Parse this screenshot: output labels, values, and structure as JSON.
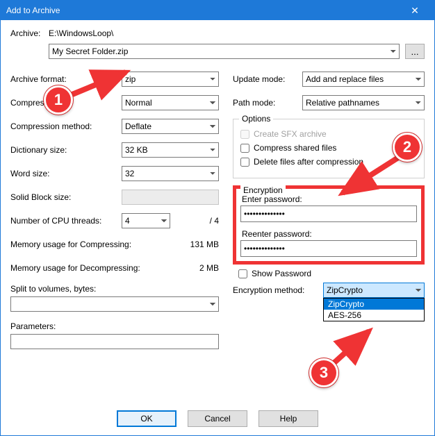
{
  "window": {
    "title": "Add to Archive"
  },
  "archive": {
    "label": "Archive:",
    "path": "E:\\WindowsLoop\\",
    "filename": "My Secret Folder.zip",
    "browse": "..."
  },
  "left": {
    "format_label": "Archive format:",
    "format_value": "zip",
    "level_label": "Compressi",
    "level_value": "Normal",
    "method_label": "Compression method:",
    "method_value": "Deflate",
    "dict_label": "Dictionary size:",
    "dict_value": "32 KB",
    "word_label": "Word size:",
    "word_value": "32",
    "solid_label": "Solid Block size:",
    "solid_value": "",
    "threads_label": "Number of CPU threads:",
    "threads_value": "4",
    "threads_max": "/ 4",
    "mem_comp_label": "Memory usage for Compressing:",
    "mem_comp_value": "131 MB",
    "mem_decomp_label": "Memory usage for Decompressing:",
    "mem_decomp_value": "2 MB",
    "split_label": "Split to volumes, bytes:",
    "params_label": "Parameters:"
  },
  "right": {
    "update_label": "Update mode:",
    "update_value": "Add and replace files",
    "path_label": "Path mode:",
    "path_value": "Relative pathnames",
    "options_title": "Options",
    "opt_sfx": "Create SFX archive",
    "opt_shared": "Compress shared files",
    "opt_delete": "Delete files after compression",
    "enc_title": "Encryption",
    "enter_pw": "Enter password:",
    "reenter_pw": "Reenter password:",
    "pw_mask": "••••••••••••••",
    "show_pw": "Show Password",
    "encmethod_label": "Encryption method:",
    "encmethod_value": "ZipCrypto",
    "encmethod_options": [
      "ZipCrypto",
      "AES-256"
    ]
  },
  "footer": {
    "ok": "OK",
    "cancel": "Cancel",
    "help": "Help"
  },
  "annotations": {
    "b1": "1",
    "b2": "2",
    "b3": "3"
  }
}
